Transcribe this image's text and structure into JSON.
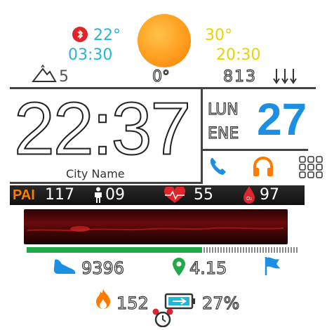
{
  "weather": {
    "current_temp": "22°",
    "sunrise": "03:30",
    "high_temp": "30°",
    "sunset": "20:30",
    "altitude_value": "5",
    "angle": "0°",
    "pressure": "813"
  },
  "clock": {
    "time": "22:37",
    "city": "City Name",
    "day_of_week": "LUN",
    "month": "ENE",
    "day": "27"
  },
  "stats": {
    "pai_label": "PAI",
    "pai_value": "117",
    "stand_value": "09",
    "heart_rate": "55",
    "spo2": "97"
  },
  "activity": {
    "steps": "9396",
    "distance": "4.15",
    "calories": "152",
    "battery": "27%"
  },
  "colors": {
    "cyan": "#23b7d6",
    "yellow": "#e8d300",
    "blue_accent": "#1a8fe3",
    "orange": "#ff7a00",
    "red": "#e0242b",
    "green": "#20a84a",
    "stats_bar": "#1c1c1c"
  },
  "icons": [
    "bluetooth-icon",
    "sun-icon",
    "mountain-icon",
    "pressure-arrows-icon",
    "phone-icon",
    "headphones-icon",
    "apps-grid-icon",
    "person-icon",
    "heart-icon",
    "blood-drop-icon",
    "shoe-icon",
    "location-pin-icon",
    "flag-icon",
    "flame-icon",
    "battery-icon",
    "alarm-icon"
  ]
}
